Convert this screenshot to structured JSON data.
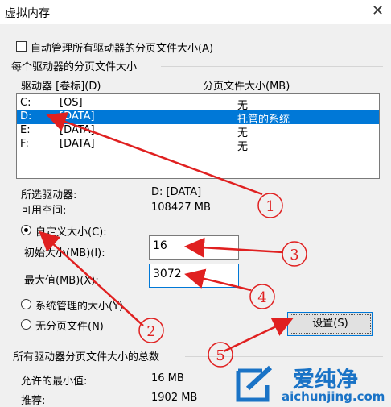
{
  "window": {
    "title": "虚拟内存"
  },
  "auto_manage": {
    "label": "自动管理所有驱动器的分页文件大小(A)",
    "checked": false
  },
  "section1": {
    "title": "每个驱动器的分页文件大小"
  },
  "table": {
    "headers": [
      "驱动器 [卷标](D)",
      "分页文件大小(MB)"
    ],
    "rows": [
      {
        "drive": "C:",
        "label": "[OS]",
        "size": "无"
      },
      {
        "drive": "D:",
        "label": "[DATA]",
        "size": "托管的系统"
      },
      {
        "drive": "E:",
        "label": "[DATA]",
        "size": "无"
      },
      {
        "drive": "F:",
        "label": "[DATA]",
        "size": "无"
      }
    ],
    "selected_index": 1
  },
  "selected_drive": {
    "label": "所选驱动器:",
    "value": "D:  [DATA]"
  },
  "available_space": {
    "label": "可用空间:",
    "value": "108427 MB"
  },
  "custom_size": {
    "label": "自定义大小(C):",
    "selected": true
  },
  "initial_size": {
    "label": "初始大小(MB)(I):",
    "value": "16"
  },
  "max_size": {
    "label": "最大值(MB)(X):",
    "value": "3072"
  },
  "system_managed": {
    "label": "系统管理的大小(Y)"
  },
  "no_paging": {
    "label": "无分页文件(N)"
  },
  "set_button": {
    "label": "设置(S)"
  },
  "section2": {
    "title": "所有驱动器分页文件大小的总数"
  },
  "min_allowed": {
    "label": "允许的最小值:",
    "value": "16 MB"
  },
  "recommended": {
    "label": "推荐:",
    "value": "1902 MB"
  },
  "annotations": [
    "1",
    "2",
    "3",
    "4",
    "5"
  ],
  "watermark": {
    "brand": "爱纯净",
    "url": "aichunjing.com"
  },
  "colors": {
    "selection": "#0078d7",
    "annotation": "#e02020",
    "watermark": "#1a73c6"
  }
}
